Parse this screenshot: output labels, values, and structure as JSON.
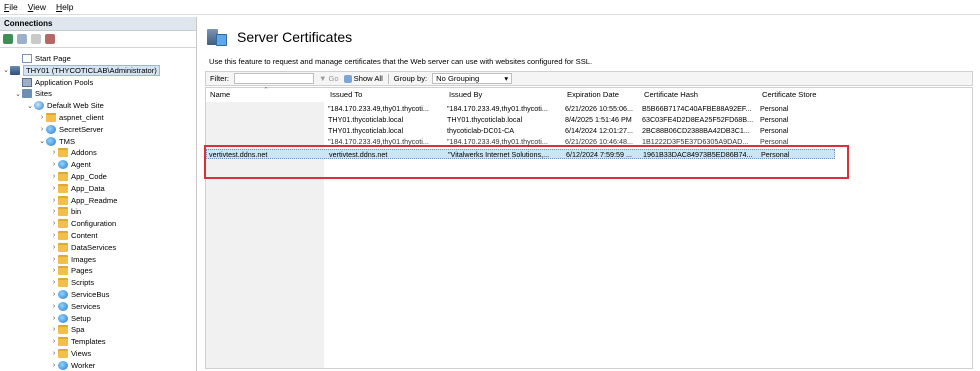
{
  "menubar": {
    "items": [
      "File",
      "View",
      "Help"
    ]
  },
  "connections": {
    "title": "Connections",
    "tree": [
      {
        "label": "Start Page",
        "icon": "start-page-icon",
        "level": 1
      },
      {
        "label": "THY01 (THYCOTICLAB\\Administrator)",
        "icon": "server-icon",
        "level": 0,
        "selected": true,
        "expanded": true
      },
      {
        "label": "Application Pools",
        "icon": "application-pools-icon",
        "level": 1
      },
      {
        "label": "Sites",
        "icon": "sites-icon",
        "level": 1,
        "expanded": true
      },
      {
        "label": "Default Web Site",
        "icon": "globe-icon",
        "level": 2,
        "expanded": true
      },
      {
        "label": "aspnet_client",
        "icon": "folder-icon",
        "level": 3
      },
      {
        "label": "SecretServer",
        "icon": "application-icon",
        "level": 3
      },
      {
        "label": "TMS",
        "icon": "application-icon",
        "level": 3,
        "expanded": true
      },
      {
        "label": "Addons",
        "icon": "folder-icon",
        "level": 4
      },
      {
        "label": "Agent",
        "icon": "application-icon",
        "level": 4
      },
      {
        "label": "App_Code",
        "icon": "folder-icon",
        "level": 4
      },
      {
        "label": "App_Data",
        "icon": "folder-icon",
        "level": 4
      },
      {
        "label": "App_Readme",
        "icon": "folder-icon",
        "level": 4
      },
      {
        "label": "bin",
        "icon": "folder-icon",
        "level": 4
      },
      {
        "label": "Configuration",
        "icon": "folder-icon",
        "level": 4
      },
      {
        "label": "Content",
        "icon": "folder-icon",
        "level": 4
      },
      {
        "label": "DataServices",
        "icon": "folder-icon",
        "level": 4
      },
      {
        "label": "Images",
        "icon": "folder-icon",
        "level": 4
      },
      {
        "label": "Pages",
        "icon": "folder-icon",
        "level": 4
      },
      {
        "label": "Scripts",
        "icon": "folder-icon",
        "level": 4
      },
      {
        "label": "ServiceBus",
        "icon": "application-icon",
        "level": 4
      },
      {
        "label": "Services",
        "icon": "application-icon",
        "level": 4
      },
      {
        "label": "Setup",
        "icon": "application-icon",
        "level": 4
      },
      {
        "label": "Spa",
        "icon": "folder-icon",
        "level": 4
      },
      {
        "label": "Templates",
        "icon": "folder-icon",
        "level": 4
      },
      {
        "label": "Views",
        "icon": "folder-icon",
        "level": 4
      },
      {
        "label": "Worker",
        "icon": "application-icon",
        "level": 4
      }
    ]
  },
  "main": {
    "title": "Server Certificates",
    "description": "Use this feature to request and manage certificates that the Web server can use with websites configured for SSL.",
    "filter": {
      "label": "Filter:",
      "go": "Go",
      "show_all": "Show All",
      "group_by_label": "Group by:",
      "group_by_value": "No Grouping"
    },
    "columns": [
      "Name",
      "Issued To",
      "Issued By",
      "Expiration Date",
      "Certificate Hash",
      "Certificate Store"
    ],
    "rows": [
      {
        "name": "",
        "issued_to": "\"184.170.233.49,thy01.thycoti...",
        "issued_by": "\"184.170.233.49,thy01.thycoti...",
        "expiration": "6/21/2026 10:55:06...",
        "hash": "B5B66B7174C40AFBE88A92EF...",
        "store": "Personal"
      },
      {
        "name": "",
        "issued_to": "THY01.thycoticlab.local",
        "issued_by": "THY01.thycoticlab.local",
        "expiration": "8/4/2025 1:51:46 PM",
        "hash": "63C03FE4D2D8EA25F52FD68B...",
        "store": "Personal"
      },
      {
        "name": "",
        "issued_to": "THY01.thycoticlab.local",
        "issued_by": "thycoticlab-DC01-CA",
        "expiration": "6/14/2024 12:01:27...",
        "hash": "2BC88B06CD2388BA42DB3C1...",
        "store": "Personal"
      },
      {
        "name": "",
        "issued_to": "\"184.170.233.49,thy01.thycoti...",
        "issued_by": "\"184.170.233.49,thy01.thycoti...",
        "expiration": "6/21/2026 10:46:48...",
        "hash": "1B1222D3F5E37D6305A9DAD...",
        "store": "Personal"
      },
      {
        "name": "vertivtest.ddns.net",
        "issued_to": "vertivtest.ddns.net",
        "issued_by": "\"Vitalwerks Internet Solutions,...",
        "expiration": "6/12/2024 7:59:59 ...",
        "hash": "1961B33DAC84973B5ED86B74...",
        "store": "Personal",
        "selected": true
      }
    ]
  },
  "colors": {
    "highlight": "#d9303a",
    "selection": "#cce4f7"
  }
}
